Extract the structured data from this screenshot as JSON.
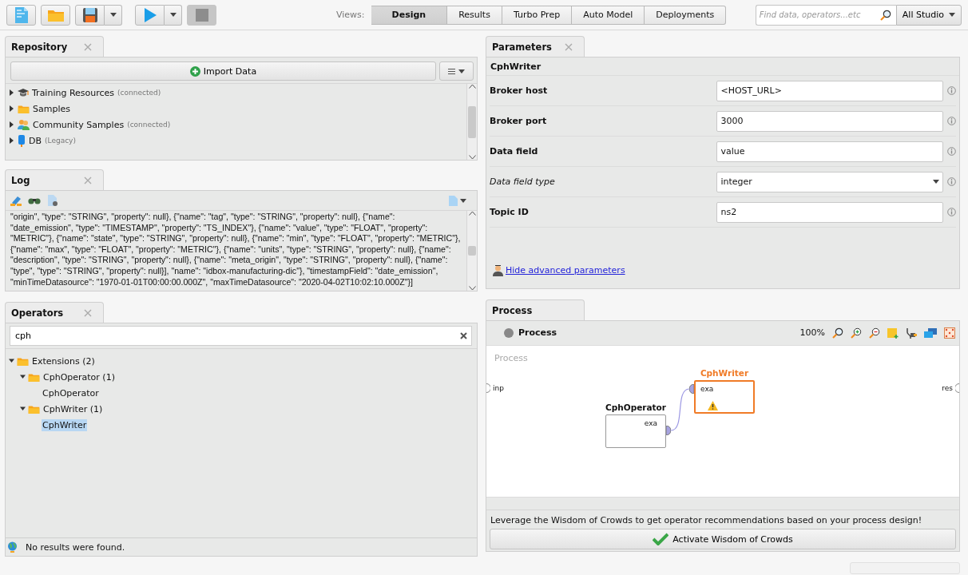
{
  "toolbar": {
    "tools": [
      {
        "kind": "new",
        "disabled": false
      },
      {
        "kind": "open",
        "disabled": false
      },
      {
        "kind": "save",
        "menu": true,
        "disabled": false
      },
      {
        "kind": "run",
        "menu": true,
        "disabled": false
      },
      {
        "kind": "stop",
        "disabled": true
      }
    ],
    "views_label": "Views:",
    "views": [
      {
        "label": "Design",
        "selected": true
      },
      {
        "label": "Results",
        "selected": false
      },
      {
        "label": "Turbo Prep",
        "selected": false
      },
      {
        "label": "Auto Model",
        "selected": false
      },
      {
        "label": "Deployments",
        "selected": false
      }
    ],
    "search": {
      "placeholder": "Find data, operators...etc"
    },
    "scope": "All Studio"
  },
  "repository": {
    "title": "Repository",
    "closable": true,
    "import_button": "Import Data",
    "items": [
      {
        "kind": "training",
        "label": "Training Resources",
        "note": "(connected)",
        "expanded": false
      },
      {
        "kind": "folder",
        "label": "Samples",
        "expanded": false
      },
      {
        "kind": "community",
        "label": "Community Samples",
        "note": "(connected)",
        "expanded": false
      },
      {
        "kind": "database",
        "label": "DB",
        "note": "(Legacy)",
        "expanded": false
      }
    ]
  },
  "log": {
    "title": "Log",
    "closable": true,
    "lines": [
      "\"origin\", \"type\": \"STRING\", \"property\": null}, {\"name\": \"tag\", \"type\": \"STRING\", \"property\": null}, {\"name\":",
      "\"date_emission\", \"type\": \"TIMESTAMP\", \"property\": \"TS_INDEX\"}, {\"name\": \"value\", \"type\": \"FLOAT\", \"property\":",
      "\"METRIC\"}, {\"name\": \"state\", \"type\": \"STRING\", \"property\": null}, {\"name\": \"min\", \"type\": \"FLOAT\", \"property\": \"METRIC\"},",
      "{\"name\": \"max\", \"type\": \"FLOAT\", \"property\": \"METRIC\"}, {\"name\": \"units\", \"type\": \"STRING\", \"property\": null}, {\"name\":",
      "\"description\", \"type\": \"STRING\", \"property\": null}, {\"name\": \"meta_origin\", \"type\": \"STRING\", \"property\": null}, {\"name\":",
      "\"type\", \"type\": \"STRING\", \"property\": null}], \"name\": \"idbox-manufacturing-dic\"}, \"timestampField\": \"date_emission\",",
      "\"minTimeDatasource\": \"1970-01-01T00:00:00.000Z\", \"maxTimeDatasource\": \"2020-04-02T10:02:10.000Z\"}]"
    ]
  },
  "operators": {
    "title": "Operators",
    "closable": true,
    "search": "cph",
    "tree": [
      {
        "label": "Extensions (2)",
        "expanded": true,
        "selected": false,
        "children": [
          {
            "label": "CphOperator (1)",
            "expanded": true,
            "selected": false,
            "children": [
              {
                "label": "CphOperator",
                "selected": false
              }
            ]
          },
          {
            "label": "CphWriter (1)",
            "expanded": true,
            "selected": false,
            "children": [
              {
                "label": "CphWriter",
                "selected": true
              }
            ]
          }
        ]
      }
    ],
    "status": "No results were found."
  },
  "parameters": {
    "title": "Parameters",
    "closable": true,
    "operator": "CphWriter",
    "params": [
      {
        "label": "Broker host",
        "kind": "text",
        "value": "<HOST_URL>",
        "expert": false
      },
      {
        "label": "Broker port",
        "kind": "text",
        "value": "3000",
        "expert": false
      },
      {
        "label": "Data field",
        "kind": "text",
        "value": "value",
        "expert": false
      },
      {
        "label": "Data field type",
        "kind": "select",
        "value": "integer",
        "expert": true
      },
      {
        "label": "Topic ID",
        "kind": "text",
        "value": "ns2",
        "expert": false
      }
    ],
    "link": "Hide advanced parameters"
  },
  "process": {
    "title": "Process",
    "closable": false,
    "breadcrumb": "Process",
    "zoom": "100%",
    "canvas_label": "Process",
    "input_port": "inp",
    "output_port": "res",
    "nodes": [
      {
        "name": "CphOperator",
        "out_port": "exa",
        "selected": false,
        "warning": false
      },
      {
        "name": "CphWriter",
        "in_port": "exa",
        "selected": true,
        "warning": true
      }
    ],
    "message": "Leverage the Wisdom of Crowds to get operator recommendations based on your process design!",
    "button": "Activate Wisdom of Crowds"
  }
}
